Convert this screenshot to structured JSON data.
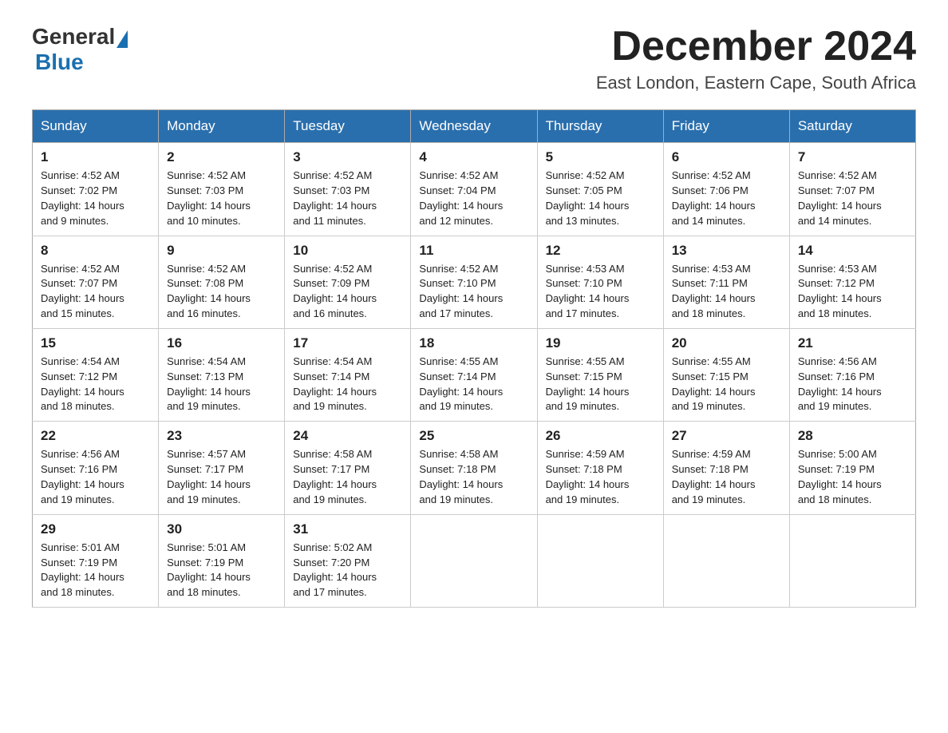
{
  "logo": {
    "general": "General",
    "blue": "Blue"
  },
  "title": "December 2024",
  "location": "East London, Eastern Cape, South Africa",
  "weekdays": [
    "Sunday",
    "Monday",
    "Tuesday",
    "Wednesday",
    "Thursday",
    "Friday",
    "Saturday"
  ],
  "weeks": [
    [
      {
        "day": "1",
        "sunrise": "4:52 AM",
        "sunset": "7:02 PM",
        "daylight": "14 hours and 9 minutes."
      },
      {
        "day": "2",
        "sunrise": "4:52 AM",
        "sunset": "7:03 PM",
        "daylight": "14 hours and 10 minutes."
      },
      {
        "day": "3",
        "sunrise": "4:52 AM",
        "sunset": "7:03 PM",
        "daylight": "14 hours and 11 minutes."
      },
      {
        "day": "4",
        "sunrise": "4:52 AM",
        "sunset": "7:04 PM",
        "daylight": "14 hours and 12 minutes."
      },
      {
        "day": "5",
        "sunrise": "4:52 AM",
        "sunset": "7:05 PM",
        "daylight": "14 hours and 13 minutes."
      },
      {
        "day": "6",
        "sunrise": "4:52 AM",
        "sunset": "7:06 PM",
        "daylight": "14 hours and 14 minutes."
      },
      {
        "day": "7",
        "sunrise": "4:52 AM",
        "sunset": "7:07 PM",
        "daylight": "14 hours and 14 minutes."
      }
    ],
    [
      {
        "day": "8",
        "sunrise": "4:52 AM",
        "sunset": "7:07 PM",
        "daylight": "14 hours and 15 minutes."
      },
      {
        "day": "9",
        "sunrise": "4:52 AM",
        "sunset": "7:08 PM",
        "daylight": "14 hours and 16 minutes."
      },
      {
        "day": "10",
        "sunrise": "4:52 AM",
        "sunset": "7:09 PM",
        "daylight": "14 hours and 16 minutes."
      },
      {
        "day": "11",
        "sunrise": "4:52 AM",
        "sunset": "7:10 PM",
        "daylight": "14 hours and 17 minutes."
      },
      {
        "day": "12",
        "sunrise": "4:53 AM",
        "sunset": "7:10 PM",
        "daylight": "14 hours and 17 minutes."
      },
      {
        "day": "13",
        "sunrise": "4:53 AM",
        "sunset": "7:11 PM",
        "daylight": "14 hours and 18 minutes."
      },
      {
        "day": "14",
        "sunrise": "4:53 AM",
        "sunset": "7:12 PM",
        "daylight": "14 hours and 18 minutes."
      }
    ],
    [
      {
        "day": "15",
        "sunrise": "4:54 AM",
        "sunset": "7:12 PM",
        "daylight": "14 hours and 18 minutes."
      },
      {
        "day": "16",
        "sunrise": "4:54 AM",
        "sunset": "7:13 PM",
        "daylight": "14 hours and 19 minutes."
      },
      {
        "day": "17",
        "sunrise": "4:54 AM",
        "sunset": "7:14 PM",
        "daylight": "14 hours and 19 minutes."
      },
      {
        "day": "18",
        "sunrise": "4:55 AM",
        "sunset": "7:14 PM",
        "daylight": "14 hours and 19 minutes."
      },
      {
        "day": "19",
        "sunrise": "4:55 AM",
        "sunset": "7:15 PM",
        "daylight": "14 hours and 19 minutes."
      },
      {
        "day": "20",
        "sunrise": "4:55 AM",
        "sunset": "7:15 PM",
        "daylight": "14 hours and 19 minutes."
      },
      {
        "day": "21",
        "sunrise": "4:56 AM",
        "sunset": "7:16 PM",
        "daylight": "14 hours and 19 minutes."
      }
    ],
    [
      {
        "day": "22",
        "sunrise": "4:56 AM",
        "sunset": "7:16 PM",
        "daylight": "14 hours and 19 minutes."
      },
      {
        "day": "23",
        "sunrise": "4:57 AM",
        "sunset": "7:17 PM",
        "daylight": "14 hours and 19 minutes."
      },
      {
        "day": "24",
        "sunrise": "4:58 AM",
        "sunset": "7:17 PM",
        "daylight": "14 hours and 19 minutes."
      },
      {
        "day": "25",
        "sunrise": "4:58 AM",
        "sunset": "7:18 PM",
        "daylight": "14 hours and 19 minutes."
      },
      {
        "day": "26",
        "sunrise": "4:59 AM",
        "sunset": "7:18 PM",
        "daylight": "14 hours and 19 minutes."
      },
      {
        "day": "27",
        "sunrise": "4:59 AM",
        "sunset": "7:18 PM",
        "daylight": "14 hours and 19 minutes."
      },
      {
        "day": "28",
        "sunrise": "5:00 AM",
        "sunset": "7:19 PM",
        "daylight": "14 hours and 18 minutes."
      }
    ],
    [
      {
        "day": "29",
        "sunrise": "5:01 AM",
        "sunset": "7:19 PM",
        "daylight": "14 hours and 18 minutes."
      },
      {
        "day": "30",
        "sunrise": "5:01 AM",
        "sunset": "7:19 PM",
        "daylight": "14 hours and 18 minutes."
      },
      {
        "day": "31",
        "sunrise": "5:02 AM",
        "sunset": "7:20 PM",
        "daylight": "14 hours and 17 minutes."
      },
      null,
      null,
      null,
      null
    ]
  ],
  "labels": {
    "sunrise": "Sunrise:",
    "sunset": "Sunset:",
    "daylight": "Daylight:"
  }
}
